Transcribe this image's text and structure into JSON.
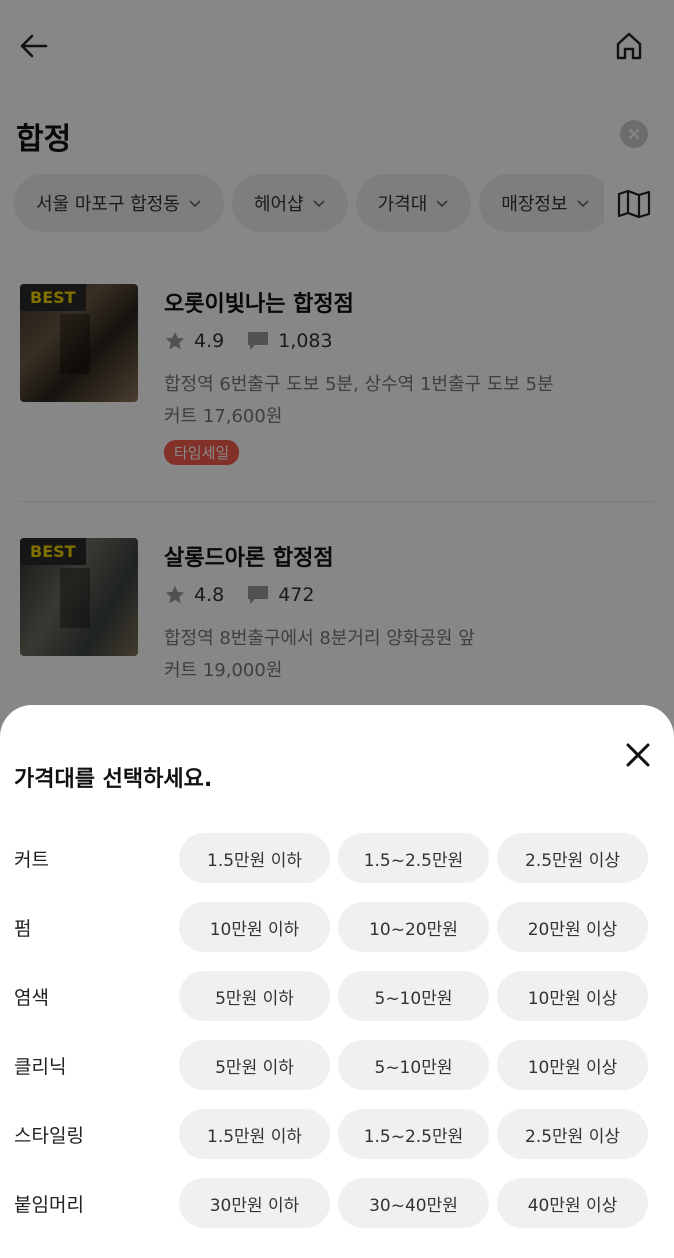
{
  "header": {
    "back_icon": "arrow-left-icon",
    "home_icon": "home-icon"
  },
  "search": {
    "query": "합정",
    "clear_icon": "clear-icon"
  },
  "filters": {
    "chips": [
      {
        "label": "서울 마포구 합정동"
      },
      {
        "label": "헤어샵"
      },
      {
        "label": "가격대"
      },
      {
        "label": "매장정보"
      }
    ],
    "map_icon": "map-icon"
  },
  "shops": [
    {
      "badge": "BEST",
      "name": "오롯이빛나는 합정점",
      "rating": "4.9",
      "reviews": "1,083",
      "address": "합정역 6번출구 도보 5분, 상수역 1번출구 도보 5분",
      "price": "커트 17,600원",
      "sale": "타임세일"
    },
    {
      "badge": "BEST",
      "name": "살롱드아론 합정점",
      "rating": "4.8",
      "reviews": "472",
      "address": "합정역 8번출구에서 8분거리 양화공원 앞",
      "price": "커트 19,000원"
    }
  ],
  "sheet": {
    "title": "가격대를 선택하세요.",
    "close_icon": "close-icon",
    "rows": [
      {
        "label": "커트",
        "options": [
          "1.5만원 이하",
          "1.5~2.5만원",
          "2.5만원 이상"
        ]
      },
      {
        "label": "펌",
        "options": [
          "10만원 이하",
          "10~20만원",
          "20만원 이상"
        ]
      },
      {
        "label": "염색",
        "options": [
          "5만원 이하",
          "5~10만원",
          "10만원 이상"
        ]
      },
      {
        "label": "클리닉",
        "options": [
          "5만원 이하",
          "5~10만원",
          "10만원 이상"
        ]
      },
      {
        "label": "스타일링",
        "options": [
          "1.5만원 이하",
          "1.5~2.5만원",
          "2.5만원 이상"
        ]
      },
      {
        "label": "붙임머리",
        "options": [
          "30만원 이하",
          "30~40만원",
          "40만원 이상"
        ]
      }
    ]
  },
  "colors": {
    "best_text": "#f2d300",
    "sale_badge": "#f55b4d",
    "overlay": "rgba(0,0,0,0.47)"
  }
}
